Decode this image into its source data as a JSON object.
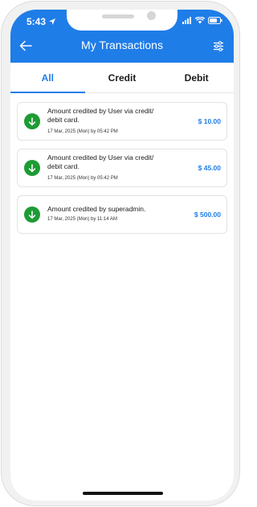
{
  "status_bar": {
    "time": "5:43"
  },
  "header": {
    "title": "My Transactions",
    "color": "#1f7de8"
  },
  "tabs": [
    {
      "label": "All",
      "active": true
    },
    {
      "label": "Credit",
      "active": false
    },
    {
      "label": "Debit",
      "active": false
    }
  ],
  "transactions": [
    {
      "description": "Amount credited by User via credit/ debit card.",
      "date": "17 Mar, 2025 (Mon) by 05:42 PM",
      "amount": "$ 10.00"
    },
    {
      "description": "Amount credited by User via credit/ debit card.",
      "date": "17 Mar, 2025 (Mon) by 05:42 PM",
      "amount": "$ 45.00"
    },
    {
      "description": "Amount credited by superadmin.",
      "date": "17 Mar, 2025 (Mon) by 11:14 AM",
      "amount": "$ 500.00"
    }
  ],
  "colors": {
    "credit_icon": "#1e9b34",
    "amount": "#1f7de8"
  },
  "icons": {
    "back": "arrow-left-icon",
    "filter": "sliders-icon",
    "credit": "arrow-down-icon"
  }
}
